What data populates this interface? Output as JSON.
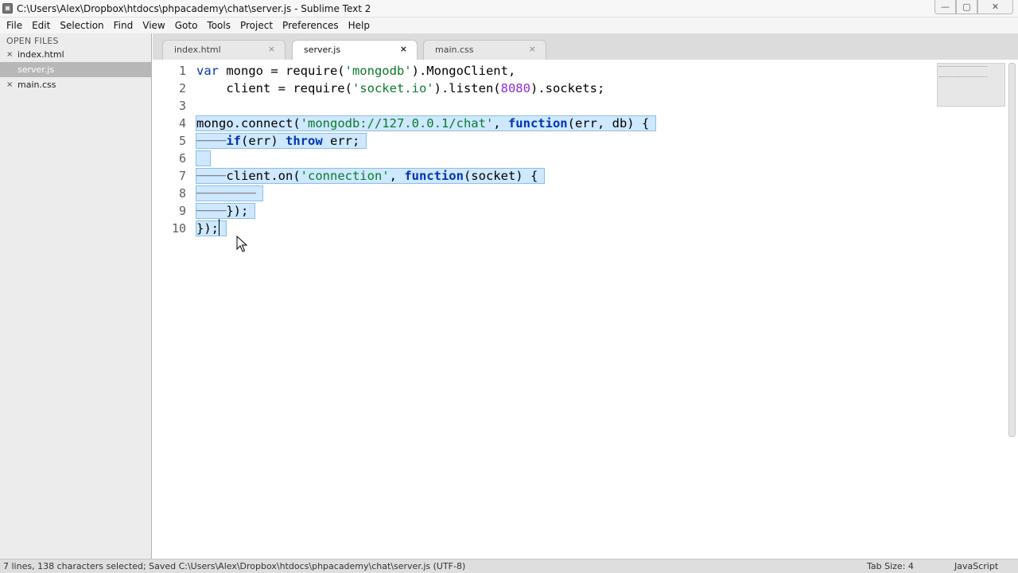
{
  "window": {
    "title": "C:\\Users\\Alex\\Dropbox\\htdocs\\phpacademy\\chat\\server.js - Sublime Text 2",
    "controls": {
      "minimize": "—",
      "maximize": "▢",
      "close": "✕"
    }
  },
  "menu": [
    "File",
    "Edit",
    "Selection",
    "Find",
    "View",
    "Goto",
    "Tools",
    "Project",
    "Preferences",
    "Help"
  ],
  "sidebar": {
    "header": "OPEN FILES",
    "files": [
      {
        "name": "index.html",
        "close": "×"
      },
      {
        "name": "server.js",
        "close": "×",
        "active": true
      },
      {
        "name": "main.css",
        "close": "×"
      }
    ]
  },
  "tabs": [
    {
      "label": "index.html",
      "close": "×"
    },
    {
      "label": "server.js",
      "close": "×",
      "active": true
    },
    {
      "label": "main.css",
      "close": "×"
    }
  ],
  "editor": {
    "line_numbers": [
      "1",
      "2",
      "3",
      "4",
      "5",
      "6",
      "7",
      "8",
      "9",
      "10"
    ],
    "lines": [
      [
        {
          "t": "var",
          "c": "kw"
        },
        {
          "t": " mongo = require("
        },
        {
          "t": "'mongodb'",
          "c": "str"
        },
        {
          "t": ").MongoClient,"
        }
      ],
      [
        {
          "t": "    client = require("
        },
        {
          "t": "'socket.io'",
          "c": "str"
        },
        {
          "t": ").listen("
        },
        {
          "t": "8080",
          "c": "num"
        },
        {
          "t": ").sockets;"
        }
      ],
      [
        {
          "t": ""
        }
      ],
      [
        {
          "t": "mongo.connect("
        },
        {
          "t": "'mongodb://127.0.0.1/chat'",
          "c": "str"
        },
        {
          "t": ", "
        },
        {
          "t": "function",
          "c": "kw-b"
        },
        {
          "t": "(err, db) {"
        }
      ],
      [
        {
          "t": "────",
          "c": "guide"
        },
        {
          "t": "if",
          "c": "kw-b"
        },
        {
          "t": "(err) "
        },
        {
          "t": "throw",
          "c": "kw-b"
        },
        {
          "t": " err;"
        }
      ],
      [
        {
          "t": " "
        }
      ],
      [
        {
          "t": "────",
          "c": "guide"
        },
        {
          "t": "client.on("
        },
        {
          "t": "'connection'",
          "c": "str"
        },
        {
          "t": ", "
        },
        {
          "t": "function",
          "c": "kw-b"
        },
        {
          "t": "(socket) {"
        }
      ],
      [
        {
          "t": "────────",
          "c": "guide"
        }
      ],
      [
        {
          "t": "────",
          "c": "guide"
        },
        {
          "t": "});"
        }
      ],
      [
        {
          "t": "});"
        }
      ]
    ],
    "selected_lines": [
      4,
      5,
      6,
      7,
      8,
      9,
      10
    ]
  },
  "status": {
    "text": "7 lines, 138 characters selected; Saved C:\\Users\\Alex\\Dropbox\\htdocs\\phpacademy\\chat\\server.js (UTF-8)",
    "tab_size": "Tab Size: 4",
    "syntax": "JavaScript"
  }
}
